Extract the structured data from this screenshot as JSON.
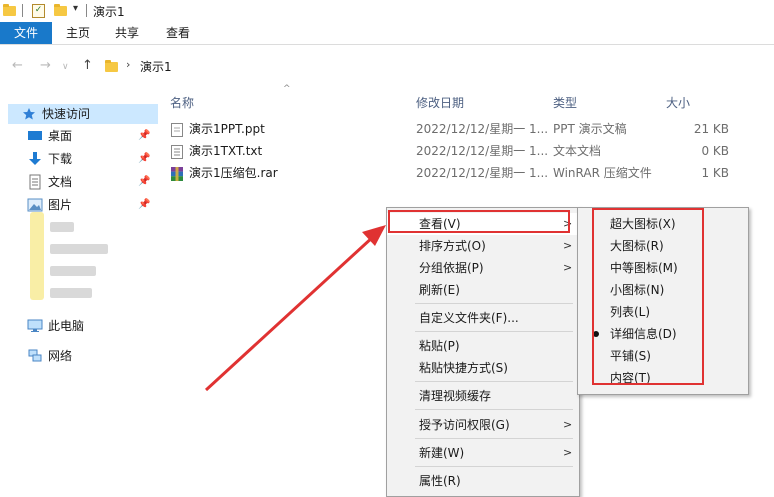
{
  "window": {
    "title": "演示1"
  },
  "ribbon": {
    "tabs": [
      "文件",
      "主页",
      "共享",
      "查看"
    ]
  },
  "address": {
    "path_item": "演示1"
  },
  "sidebar": {
    "quick_access": "快速访问",
    "items": [
      {
        "label": "桌面",
        "icon": "desktop-icon"
      },
      {
        "label": "下载",
        "icon": "download-icon"
      },
      {
        "label": "文档",
        "icon": "document-icon"
      },
      {
        "label": "图片",
        "icon": "picture-icon"
      }
    ],
    "this_pc": "此电脑",
    "network": "网络"
  },
  "columns": {
    "name": "名称",
    "date": "修改日期",
    "type": "类型",
    "size": "大小"
  },
  "files": [
    {
      "name": "演示1PPT.ppt",
      "date": "2022/12/12/星期一 1...",
      "type": "PPT 演示文稿",
      "size": "21 KB",
      "icon": "ppt-file-icon"
    },
    {
      "name": "演示1TXT.txt",
      "date": "2022/12/12/星期一 1...",
      "type": "文本文档",
      "size": "0 KB",
      "icon": "txt-file-icon"
    },
    {
      "name": "演示1压缩包.rar",
      "date": "2022/12/12/星期一 1...",
      "type": "WinRAR 压缩文件",
      "size": "1 KB",
      "icon": "rar-file-icon"
    }
  ],
  "context_menu": {
    "view": "查看(V)",
    "sort_by": "排序方式(O)",
    "group_by": "分组依据(P)",
    "refresh": "刷新(E)",
    "customize": "自定义文件夹(F)...",
    "paste": "粘贴(P)",
    "paste_shortcut": "粘贴快捷方式(S)",
    "clear_video_cache": "清理视频缓存",
    "grant_access": "授予访问权限(G)",
    "new": "新建(W)",
    "properties": "属性(R)"
  },
  "view_submenu": {
    "items": [
      "超大图标(X)",
      "大图标(R)",
      "中等图标(M)",
      "小图标(N)",
      "列表(L)",
      "详细信息(D)",
      "平铺(S)",
      "内容(T)"
    ],
    "selected": "详细信息(D)"
  },
  "colors": {
    "accent": "#1979ca",
    "annotation": "#e03232",
    "folder": "#f6c843"
  }
}
